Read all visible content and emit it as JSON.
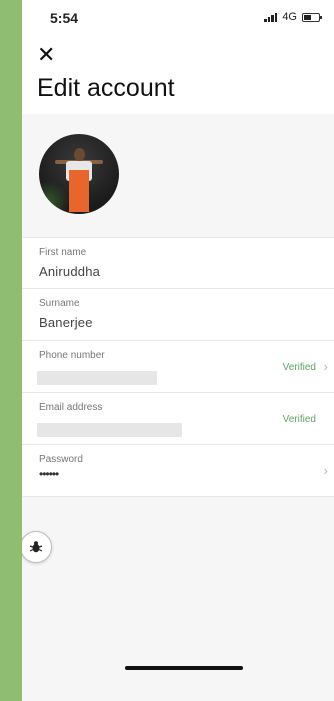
{
  "status_bar": {
    "time": "5:54",
    "network": "4G"
  },
  "header": {
    "close_icon": "close-icon",
    "title": "Edit account"
  },
  "profile": {
    "avatar_icon": "profile-photo"
  },
  "fields": [
    {
      "label": "First name",
      "value": "Aniruddha"
    },
    {
      "label": "Surname",
      "value": "Banerjee"
    },
    {
      "label": "Phone number",
      "status": "Verified"
    },
    {
      "label": "Email address",
      "status": "Verified"
    },
    {
      "label": "Password",
      "value": "••••••"
    }
  ],
  "colors": {
    "verified": "#5fa564",
    "background": "#f6f6f6",
    "frame": "#8fbd72"
  }
}
